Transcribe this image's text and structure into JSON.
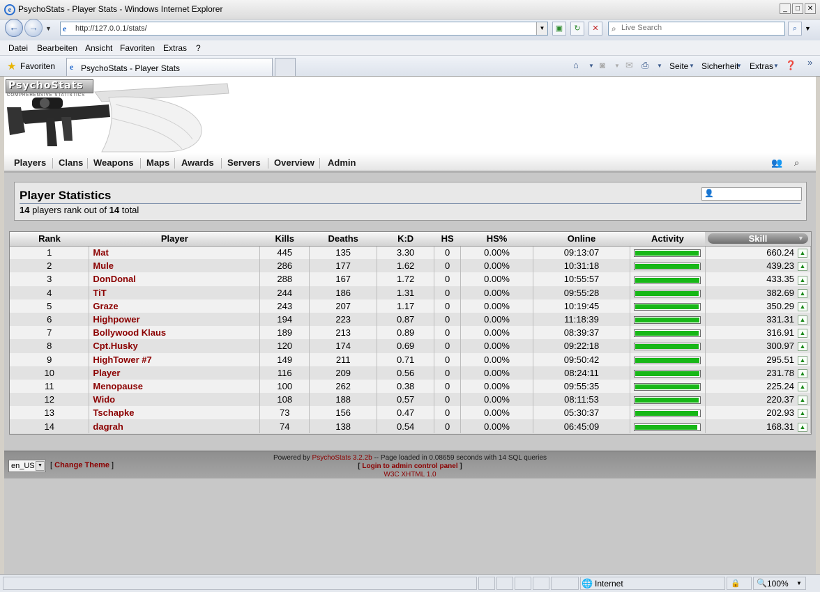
{
  "browser": {
    "window_title": "PsychoStats - Player Stats - Windows Internet Explorer",
    "address": "http://127.0.0.1/stats/",
    "search_placeholder": "Live Search",
    "menu": [
      "Datei",
      "Bearbeiten",
      "Ansicht",
      "Favoriten",
      "Extras",
      "?"
    ],
    "favorites_label": "Favoriten",
    "tab_title": "PsychoStats - Player Stats",
    "commands": {
      "page": "Seite",
      "security": "Sicherheit",
      "tools": "Extras"
    },
    "status": {
      "zone": "Internet",
      "zoom": "100%"
    }
  },
  "site": {
    "logo_text": "PsychoStats",
    "logo_subtitle": "COMPREHENSIVE STATISTICS",
    "nav": [
      "Players",
      "Clans",
      "Weapons",
      "Maps",
      "Awards",
      "Servers",
      "Overview",
      "Admin"
    ]
  },
  "stats": {
    "title": "Player Statistics",
    "ranked_count": "14",
    "total_count": "14",
    "summary_mid": " players rank out of ",
    "summary_end": " total",
    "columns": [
      "Rank",
      "Player",
      "Kills",
      "Deaths",
      "K:D",
      "HS",
      "HS%",
      "Online",
      "Activity",
      "Skill"
    ],
    "rows": [
      {
        "rank": "1",
        "player": "Mat",
        "kills": "445",
        "deaths": "135",
        "kd": "3.30",
        "hs": "0",
        "hs_pct": "0.00%",
        "online": "09:13:07",
        "activity": 0.99,
        "skill": "660.24"
      },
      {
        "rank": "2",
        "player": "Mule",
        "kills": "286",
        "deaths": "177",
        "kd": "1.62",
        "hs": "0",
        "hs_pct": "0.00%",
        "online": "10:31:18",
        "activity": 1.0,
        "skill": "439.23"
      },
      {
        "rank": "3",
        "player": "DonDonal",
        "kills": "288",
        "deaths": "167",
        "kd": "1.72",
        "hs": "0",
        "hs_pct": "0.00%",
        "online": "10:55:57",
        "activity": 1.0,
        "skill": "433.35"
      },
      {
        "rank": "4",
        "player": "TiT",
        "kills": "244",
        "deaths": "186",
        "kd": "1.31",
        "hs": "0",
        "hs_pct": "0.00%",
        "online": "09:55:28",
        "activity": 0.99,
        "skill": "382.69"
      },
      {
        "rank": "5",
        "player": "Graze",
        "kills": "243",
        "deaths": "207",
        "kd": "1.17",
        "hs": "0",
        "hs_pct": "0.00%",
        "online": "10:19:45",
        "activity": 0.99,
        "skill": "350.29"
      },
      {
        "rank": "6",
        "player": "Highpower",
        "kills": "194",
        "deaths": "223",
        "kd": "0.87",
        "hs": "0",
        "hs_pct": "0.00%",
        "online": "11:18:39",
        "activity": 1.0,
        "skill": "331.31"
      },
      {
        "rank": "7",
        "player": "Bollywood Klaus",
        "kills": "189",
        "deaths": "213",
        "kd": "0.89",
        "hs": "0",
        "hs_pct": "0.00%",
        "online": "08:39:37",
        "activity": 0.99,
        "skill": "316.91"
      },
      {
        "rank": "8",
        "player": "Cpt.Husky",
        "kills": "120",
        "deaths": "174",
        "kd": "0.69",
        "hs": "0",
        "hs_pct": "0.00%",
        "online": "09:22:18",
        "activity": 0.99,
        "skill": "300.97"
      },
      {
        "rank": "9",
        "player": "HighTower #7",
        "kills": "149",
        "deaths": "211",
        "kd": "0.71",
        "hs": "0",
        "hs_pct": "0.00%",
        "online": "09:50:42",
        "activity": 1.0,
        "skill": "295.51"
      },
      {
        "rank": "10",
        "player": "Player",
        "kills": "116",
        "deaths": "209",
        "kd": "0.56",
        "hs": "0",
        "hs_pct": "0.00%",
        "online": "08:24:11",
        "activity": 1.0,
        "skill": "231.78"
      },
      {
        "rank": "11",
        "player": "Menopause",
        "kills": "100",
        "deaths": "262",
        "kd": "0.38",
        "hs": "0",
        "hs_pct": "0.00%",
        "online": "09:55:35",
        "activity": 1.0,
        "skill": "225.24"
      },
      {
        "rank": "12",
        "player": "Wido",
        "kills": "108",
        "deaths": "188",
        "kd": "0.57",
        "hs": "0",
        "hs_pct": "0.00%",
        "online": "08:11:53",
        "activity": 0.99,
        "skill": "220.37"
      },
      {
        "rank": "13",
        "player": "Tschapke",
        "kills": "73",
        "deaths": "156",
        "kd": "0.47",
        "hs": "0",
        "hs_pct": "0.00%",
        "online": "05:30:37",
        "activity": 0.98,
        "skill": "202.93"
      },
      {
        "rank": "14",
        "player": "dagrah",
        "kills": "74",
        "deaths": "138",
        "kd": "0.54",
        "hs": "0",
        "hs_pct": "0.00%",
        "online": "06:45:09",
        "activity": 0.97,
        "skill": "168.31"
      }
    ]
  },
  "footer": {
    "language": "en_US",
    "change_theme": "Change Theme",
    "powered_by": "Powered by ",
    "product": "PsychoStats 3.2.2b",
    "load_info": " -- Page loaded in 0.08659 seconds with 14 SQL queries",
    "admin_login": "Login to admin control panel",
    "w3c": "W3C XHTML 1.0"
  },
  "colors": {
    "link": "#8b0000",
    "activity_bar": "#17b717"
  }
}
